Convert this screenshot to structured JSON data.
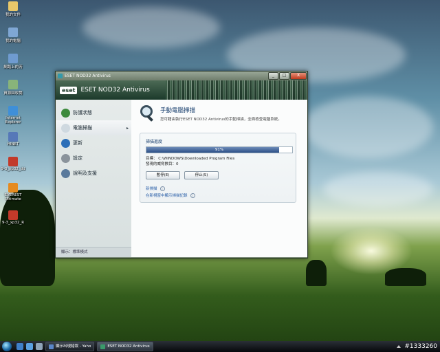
{
  "desktop": {
    "icons": [
      {
        "label": "我的文件",
        "icon": "documents-icon",
        "color": "#e9c86a"
      },
      {
        "label": "我的電腦",
        "icon": "computer-icon",
        "color": "#7fa7d4"
      },
      {
        "label": "網路上的芳",
        "icon": "network-icon",
        "color": "#6f9bd0"
      },
      {
        "label": "資源回收筒",
        "icon": "recycle-bin-icon",
        "color": "#88b47a"
      },
      {
        "label": "Internet Explorer",
        "icon": "ie-icon",
        "color": "#3f8fd8"
      },
      {
        "label": "HINET",
        "icon": "hinet-icon",
        "color": "#5678b8"
      },
      {
        "label": "9-3_xp32_dd",
        "icon": "ati-icon",
        "color": "#c23a2a"
      },
      {
        "label": "EVEREST Ultimate",
        "icon": "everest-icon",
        "color": "#e58a1f"
      },
      {
        "label": "9-3_xp32_R",
        "icon": "ati-icon",
        "color": "#c23a2a"
      }
    ]
  },
  "window": {
    "title": "ESET NOD32 Antivirus",
    "controls": {
      "minimize": "_",
      "maximize": "□",
      "close": "X"
    },
    "header": {
      "logo": "eset",
      "product": "ESET NOD32 Antivirus"
    },
    "sidebar": {
      "items": [
        {
          "label": "防護狀態",
          "icon": "protection-status-icon",
          "color": "#3b8a3b"
        },
        {
          "label": "電腦掃描",
          "icon": "computer-scan-icon",
          "color": "#cfd9e0",
          "active": true
        },
        {
          "label": "更新",
          "icon": "update-icon",
          "color": "#2d6fb8"
        },
        {
          "label": "設定",
          "icon": "setup-icon",
          "color": "#8a939b"
        },
        {
          "label": "說明及支援",
          "icon": "help-icon",
          "color": "#5a7a9c"
        }
      ],
      "active_arrow": "▸",
      "mode": "顯示：標準模式"
    },
    "main": {
      "title": "手動電腦掃描",
      "description": "您可藉由執行ESET NOD32 Antivirus的手動掃描，全面檢查電腦系統。",
      "panel": {
        "title": "掃描進度",
        "progress": 0.91,
        "progress_text": "91%",
        "target": "目標： C:\\WINDOWS\\Downloaded Program Files",
        "threats": "發現的威脅數目：0",
        "pause_button": "暫停(E)",
        "stop_button": "停止(S)",
        "new_scan_link": "新掃描",
        "log_link": "在新視窗中顯示掃描記錄"
      }
    }
  },
  "taskbar": {
    "tasks": [
      {
        "label": "顯示出現錯誤 - Yaho",
        "active": false
      },
      {
        "label": "ESET NOD32 Antivirus",
        "active": true
      }
    ],
    "tray_text": "#1333260"
  }
}
